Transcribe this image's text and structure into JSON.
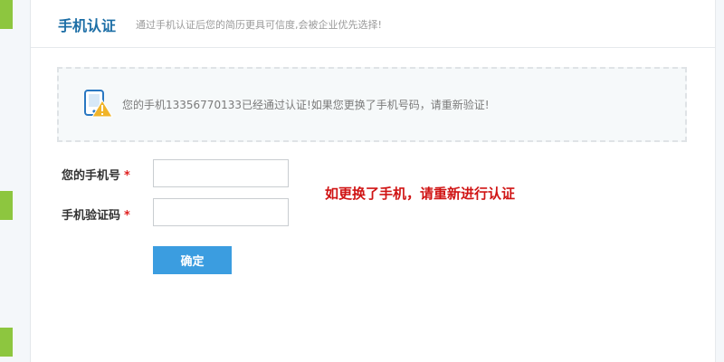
{
  "header": {
    "title": "手机认证",
    "subtitle": "通过手机认证后您的简历更具可信度,会被企业优先选择!"
  },
  "notice": {
    "icon": "phone-warning-icon",
    "text": "您的手机13356770133已经通过认证!如果您更换了手机号码，请重新验证!"
  },
  "form": {
    "phone_label": "您的手机号",
    "code_label": "手机验证码",
    "required_mark": "*",
    "phone_value": "",
    "code_value": "",
    "submit_label": "确定"
  },
  "hint": "如更换了手机，请重新进行认证",
  "colors": {
    "title": "#1c6ea6",
    "accent_button": "#3b9de0",
    "hint_red": "#d01414",
    "rail_green": "#8dc63f"
  }
}
